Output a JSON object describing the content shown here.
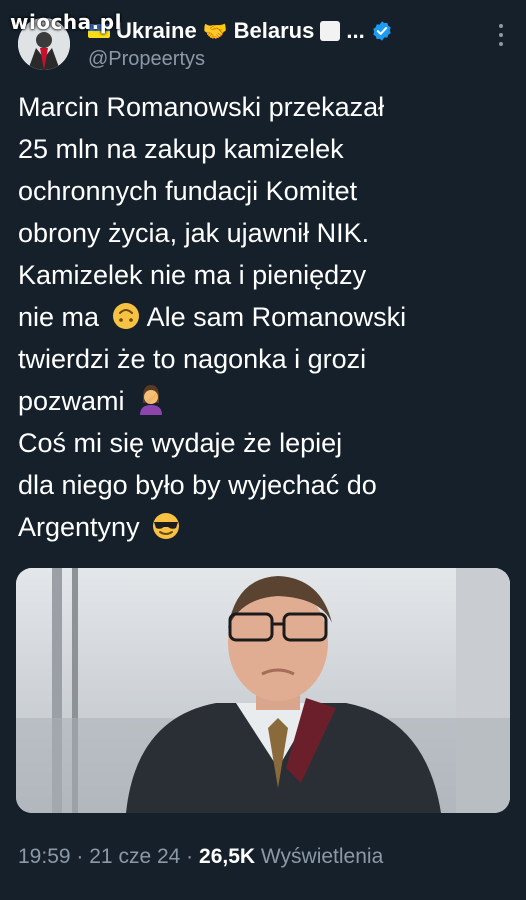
{
  "watermark": "wiocha.pl",
  "author": {
    "name_prefix": "Ukraine",
    "name_suffix": "Belarus",
    "ellipsis": "...",
    "handle": "@Propeertys"
  },
  "tweet": {
    "lines": [
      "Marcin Romanowski przekazał",
      "25 mln na zakup kamizelek",
      "ochronnych fundacji Komitet",
      "obrony życia, jak ujawnił NIK.",
      "Kamizelek nie ma i pieniędzy",
      "nie ma",
      "Ale sam Romanowski",
      "twierdzi że to nagonka i grozi",
      "pozwami",
      "Coś mi się wydaje że lepiej",
      "dla niego było by wyjechać do",
      "Argentyny"
    ]
  },
  "meta": {
    "time": "19:59",
    "sep1": "·",
    "date": "21 cze 24",
    "sep2": "·",
    "views_count": "26,5K",
    "views_label": "Wyświetlenia"
  },
  "colors": {
    "background": "#15202b",
    "secondary_text": "#8b98a5",
    "verified": "#1d9bf0"
  },
  "icons": [
    "avatar",
    "ukraine-flag",
    "handshake-emoji",
    "white-square-emoji",
    "verified-badge-icon",
    "more-options-icon",
    "upside-down-face-emoji",
    "facepalm-emoji",
    "sunglasses-emoji"
  ]
}
